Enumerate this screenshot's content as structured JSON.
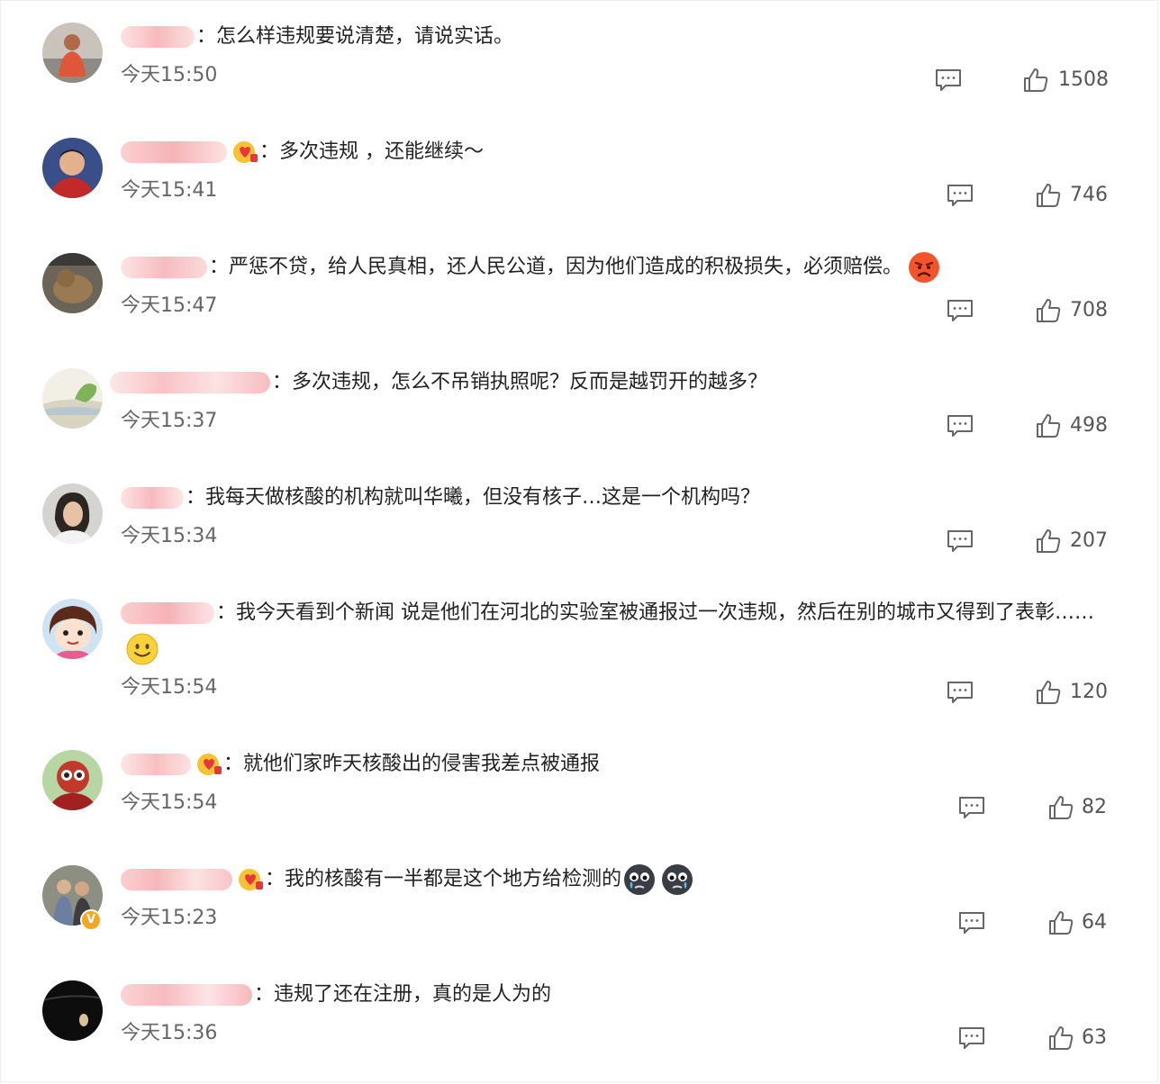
{
  "comments": [
    {
      "text": "：怎么样违规要说清楚，请说实话。",
      "time": "今天15:50",
      "likes": "1508",
      "avatar_icon": "person-outdoor-avatar-icon"
    },
    {
      "text": "：多次违规 ，还能继续～",
      "time": "今天15:41",
      "likes": "746",
      "avatar_icon": "man-portrait-avatar-icon",
      "badge_icon": "fan-heart-badge-icon"
    },
    {
      "text": "：严惩不贷，给人民真相，还人民公道，因为他们造成的积极损失，必须赔偿。",
      "time": "今天15:47",
      "likes": "708",
      "avatar_icon": "animal-avatar-icon",
      "emoji_icon": "angry-face-emoji-icon"
    },
    {
      "text": "：多次违规，怎么不吊销执照呢？反而是越罚开的越多？",
      "time": "今天15:37",
      "likes": "498",
      "avatar_icon": "landscape-avatar-icon"
    },
    {
      "text": "：我每天做核酸的机构就叫华曦，但没有核子…这是一个机构吗？",
      "time": "今天15:34",
      "likes": "207",
      "avatar_icon": "woman-portrait-avatar-icon"
    },
    {
      "text": "：我今天看到个新闻 说是他们在河北的实验室被通报过一次违规，然后在别的城市又得到了表彰……",
      "time": "今天15:54",
      "likes": "120",
      "avatar_icon": "cartoon-girl-avatar-icon",
      "emoji_icon": "smile-face-emoji-icon"
    },
    {
      "text": "：就他们家昨天核酸出的侵害我差点被通报",
      "time": "今天15:54",
      "likes": "82",
      "avatar_icon": "cartoon-character-avatar-icon",
      "badge_icon": "fan-heart-badge-icon"
    },
    {
      "text": "：我的核酸有一半都是这个地方给检测的",
      "time": "今天15:23",
      "likes": "64",
      "avatar_icon": "couple-photo-avatar-icon",
      "badge_icon": "fan-heart-badge-icon",
      "emoji_icon": "crying-face-emoji-icon",
      "verified": "V"
    },
    {
      "text": "：违规了还在注册，真的是人为的",
      "time": "今天15:36",
      "likes": "63",
      "avatar_icon": "dark-night-avatar-icon"
    }
  ],
  "icons": {
    "reply": "comment-bubble-icon",
    "like": "thumbs-up-icon"
  },
  "colors": {
    "text": "#222222",
    "time": "#666666",
    "icon": "#666666",
    "blurred_name": "#f9c9c9"
  }
}
